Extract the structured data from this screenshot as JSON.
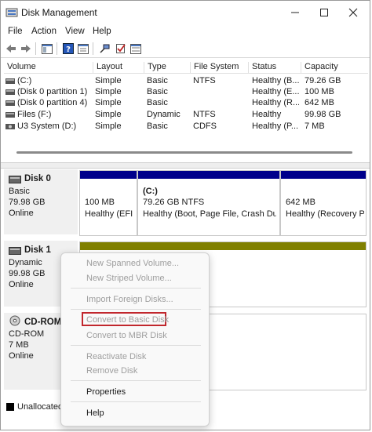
{
  "window": {
    "title": "Disk Management"
  },
  "menubar": [
    "File",
    "Action",
    "View",
    "Help"
  ],
  "toolbar": {
    "icons": [
      "back-icon",
      "forward-icon",
      "console-tree-icon",
      "help-icon",
      "properties-icon",
      "connect-icon",
      "check-icon",
      "refresh-icon"
    ]
  },
  "volume_list": {
    "headers": [
      "Volume",
      "Layout",
      "Type",
      "File System",
      "Status",
      "Capacity"
    ],
    "rows": [
      {
        "volume": "(C:)",
        "layout": "Simple",
        "type": "Basic",
        "fs": "NTFS",
        "status": "Healthy (B...",
        "capacity": "79.26 GB"
      },
      {
        "volume": "(Disk 0 partition 1)",
        "layout": "Simple",
        "type": "Basic",
        "fs": "",
        "status": "Healthy (E...",
        "capacity": "100 MB"
      },
      {
        "volume": "(Disk 0 partition 4)",
        "layout": "Simple",
        "type": "Basic",
        "fs": "",
        "status": "Healthy (R...",
        "capacity": "642 MB"
      },
      {
        "volume": "Files (F:)",
        "layout": "Simple",
        "type": "Dynamic",
        "fs": "NTFS",
        "status": "Healthy",
        "capacity": "99.98 GB"
      },
      {
        "volume": "U3 System (D:)",
        "layout": "Simple",
        "type": "Basic",
        "fs": "CDFS",
        "status": "Healthy (P...",
        "capacity": "7 MB"
      }
    ]
  },
  "disks": {
    "disk0": {
      "name": "Disk 0",
      "type": "Basic",
      "size": "79.98 GB",
      "state": "Online",
      "partitions": [
        {
          "title": "",
          "line1": "100 MB",
          "line2": "Healthy (EFI S"
        },
        {
          "title": "(C:)",
          "line1": "79.26 GB NTFS",
          "line2": "Healthy (Boot, Page File, Crash Dump"
        },
        {
          "title": "",
          "line1": "642 MB",
          "line2": "Healthy (Recovery P"
        }
      ],
      "color": "#00008b"
    },
    "disk1": {
      "name": "Disk 1",
      "type": "Dynamic",
      "size": "99.98 GB",
      "state": "Online",
      "color": "#808000"
    },
    "cdrom": {
      "name": "CD-ROM",
      "type": "CD-ROM",
      "size": "7 MB",
      "state": "Online"
    }
  },
  "legend": {
    "unallocated": "Unallocated"
  },
  "context_menu": {
    "items": [
      {
        "label": "New Spanned Volume...",
        "enabled": false
      },
      {
        "label": "New Striped Volume...",
        "enabled": false
      },
      {
        "label": "Import Foreign Disks...",
        "enabled": false
      },
      {
        "label": "Convert to Basic Disk",
        "enabled": false,
        "highlighted": true
      },
      {
        "label": "Convert to MBR Disk",
        "enabled": false
      },
      {
        "label": "Reactivate Disk",
        "enabled": false
      },
      {
        "label": "Remove Disk",
        "enabled": false
      },
      {
        "label": "Properties",
        "enabled": true
      },
      {
        "label": "Help",
        "enabled": true
      }
    ],
    "highlight_color": "#c1272d"
  }
}
